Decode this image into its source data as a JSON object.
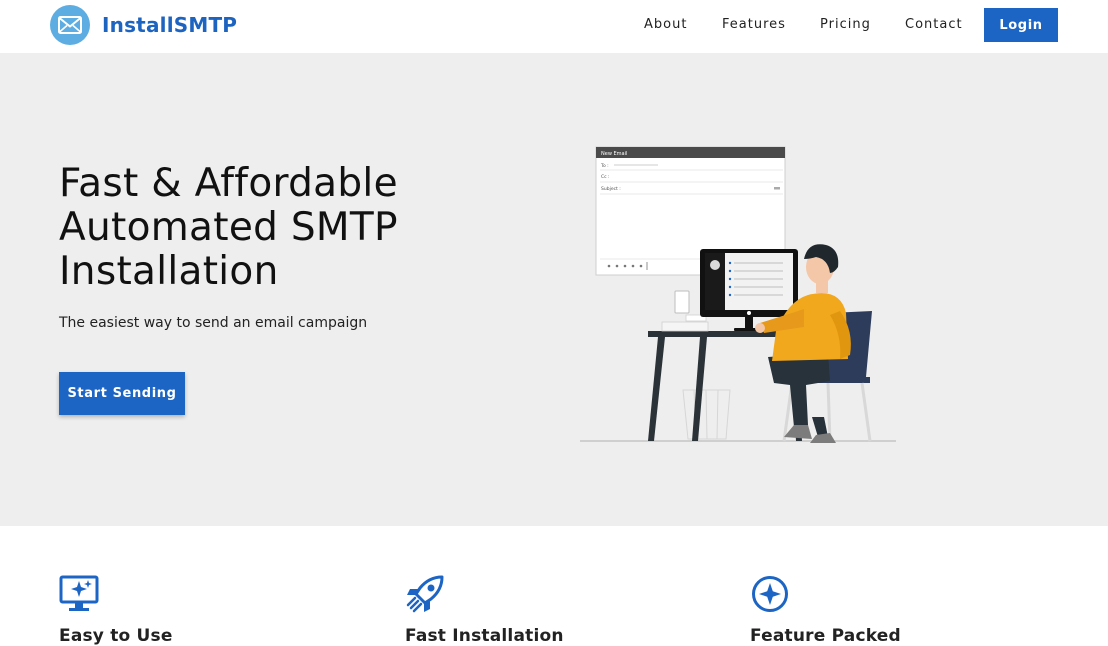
{
  "brand": {
    "name": "InstallSMTP",
    "logo_icon": "envelope-icon",
    "color": "#1d63c0"
  },
  "nav": {
    "items": [
      {
        "label": "About"
      },
      {
        "label": "Features"
      },
      {
        "label": "Pricing"
      },
      {
        "label": "Contact"
      }
    ],
    "login_label": "Login"
  },
  "hero": {
    "title_lines": [
      "Fast & Affordable",
      "Automated SMTP",
      "Installation"
    ],
    "subtitle": "The easiest way to send an email campaign",
    "cta_label": "Start Sending",
    "background": "#eeeeee",
    "illustration": {
      "window_title": "New Email",
      "to_label": "To :",
      "cc_label": "Cc :",
      "subject_label": "Subject :"
    }
  },
  "features": [
    {
      "icon": "monitor-sparkle-icon",
      "title": "Easy to Use"
    },
    {
      "icon": "rocket-icon",
      "title": "Fast Installation"
    },
    {
      "icon": "star-circle-icon",
      "title": "Feature Packed"
    }
  ],
  "colors": {
    "accent": "#1c65c4"
  }
}
